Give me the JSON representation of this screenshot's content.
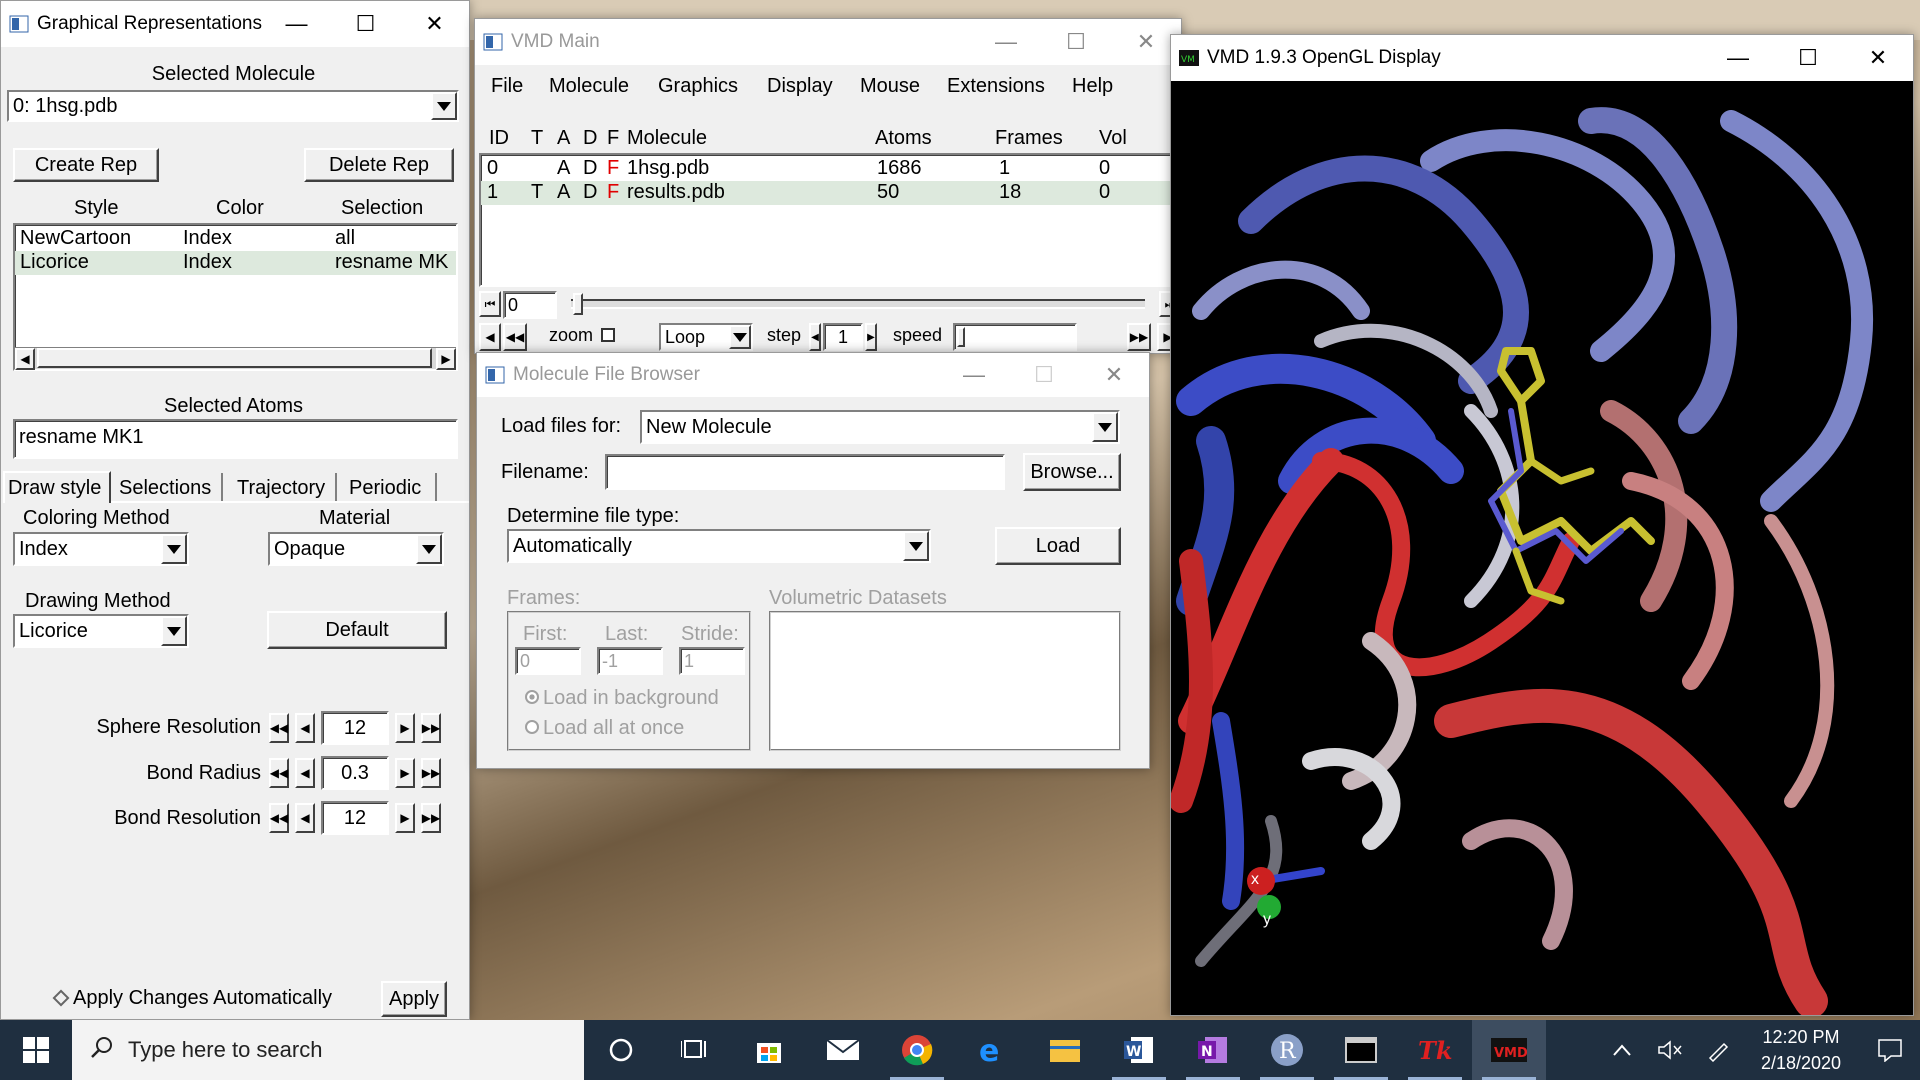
{
  "graphical_reps": {
    "title": "Graphical Representations",
    "selected_molecule_label": "Selected Molecule",
    "selected_molecule_value": "0: 1hsg.pdb",
    "create_rep": "Create Rep",
    "delete_rep": "Delete Rep",
    "columns": [
      "Style",
      "Color",
      "Selection"
    ],
    "reps": [
      {
        "style": "NewCartoon",
        "color": "Index",
        "selection": "all"
      },
      {
        "style": "Licorice",
        "color": "Index",
        "selection": "resname MK"
      }
    ],
    "selected_atoms_label": "Selected Atoms",
    "selected_atoms_value": "resname MK1",
    "tabs": [
      "Draw style",
      "Selections",
      "Trajectory",
      "Periodic"
    ],
    "coloring_method_label": "Coloring Method",
    "coloring_method_value": "Index",
    "material_label": "Material",
    "material_value": "Opaque",
    "drawing_method_label": "Drawing Method",
    "drawing_method_value": "Licorice",
    "default_button": "Default",
    "sphere_resolution_label": "Sphere Resolution",
    "sphere_resolution_value": "12",
    "bond_radius_label": "Bond Radius",
    "bond_radius_value": "0.3",
    "bond_resolution_label": "Bond Resolution",
    "bond_resolution_value": "12",
    "apply_auto_label": "Apply Changes Automatically",
    "apply_button": "Apply"
  },
  "vmd_main": {
    "title": "VMD Main",
    "menu": [
      "File",
      "Molecule",
      "Graphics",
      "Display",
      "Mouse",
      "Extensions",
      "Help"
    ],
    "columns": [
      "ID",
      "T",
      "A",
      "D",
      "F",
      "Molecule",
      "Atoms",
      "Frames",
      "Vol"
    ],
    "molecules": [
      {
        "id": "0",
        "t": "",
        "a": "A",
        "d": "D",
        "f": "F",
        "name": "1hsg.pdb",
        "atoms": "1686",
        "frames": "1",
        "vol": "0"
      },
      {
        "id": "1",
        "t": "T",
        "a": "A",
        "d": "D",
        "f": "F",
        "name": "results.pdb",
        "atoms": "50",
        "frames": "18",
        "vol": "0"
      }
    ],
    "frame_value": "0",
    "zoom_label": "zoom",
    "loop_value": "Loop",
    "step_label": "step",
    "step_value": "1",
    "speed_label": "speed"
  },
  "file_browser": {
    "title": "Molecule File Browser",
    "load_files_for_label": "Load files for:",
    "load_files_for_value": "New Molecule",
    "filename_label": "Filename:",
    "filename_value": "",
    "browse_button": "Browse...",
    "file_type_label": "Determine file type:",
    "file_type_value": "Automatically",
    "load_button": "Load",
    "frames_label": "Frames:",
    "first_label": "First:",
    "last_label": "Last:",
    "stride_label": "Stride:",
    "first_value": "0",
    "last_value": "-1",
    "stride_value": "1",
    "load_background": "Load in background",
    "load_all": "Load all at once",
    "volumetric_label": "Volumetric Datasets"
  },
  "opengl": {
    "title": "VMD 1.9.3 OpenGL Display",
    "axis_x": "x",
    "axis_y": "y"
  },
  "taskbar": {
    "search_placeholder": "Type here to search",
    "time": "12:20 PM",
    "date": "2/18/2020"
  }
}
